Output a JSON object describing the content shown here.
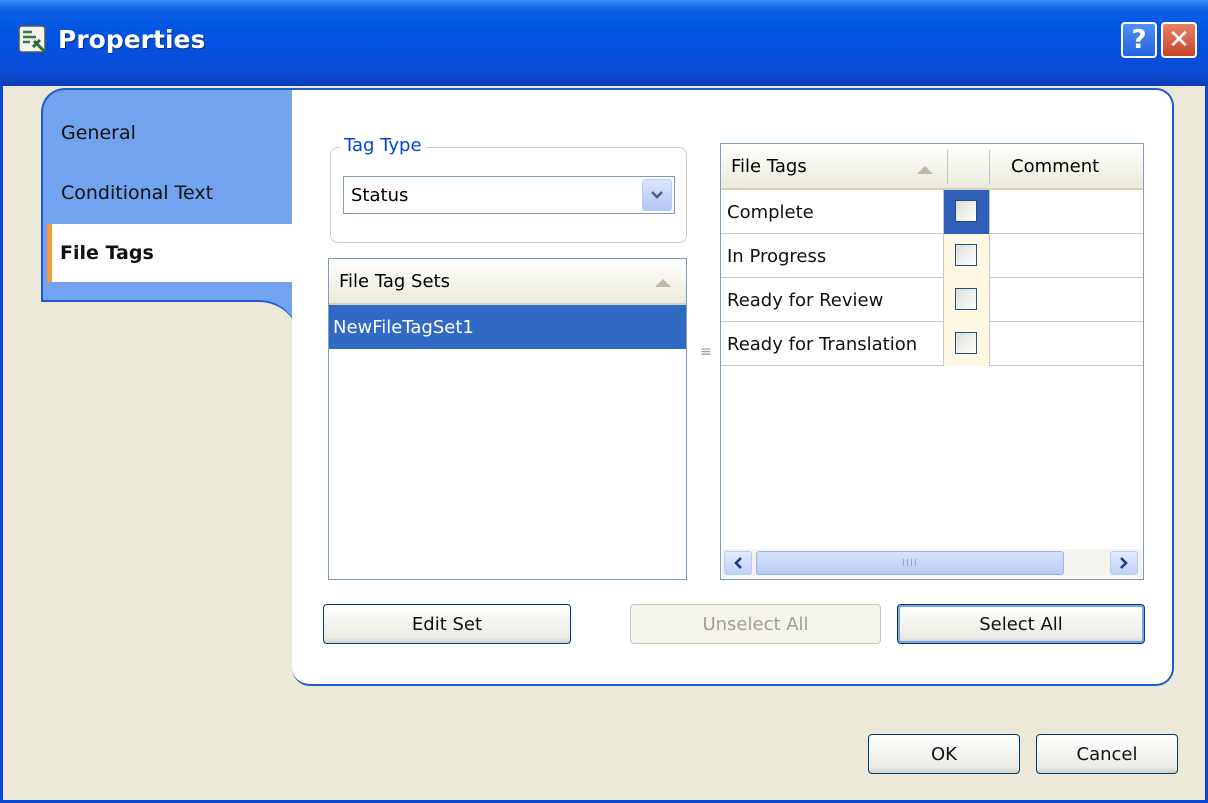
{
  "window": {
    "title": "Properties"
  },
  "titlebar": {
    "help_label": "?",
    "close_label": "✕"
  },
  "sidebar": {
    "tabs": [
      {
        "label": "General"
      },
      {
        "label": "Conditional Text"
      },
      {
        "label": "File Tags",
        "selected": true
      }
    ]
  },
  "tag_type": {
    "legend": "Tag Type",
    "selected_value": "Status"
  },
  "file_tag_sets": {
    "header": "File Tag Sets",
    "items": [
      "NewFileTagSet1"
    ],
    "selected_index": 0
  },
  "file_tags": {
    "columns": [
      "File Tags",
      "",
      "Comment"
    ],
    "rows": [
      {
        "name": "Complete",
        "checked": false,
        "comment": ""
      },
      {
        "name": "In Progress",
        "checked": false,
        "comment": ""
      },
      {
        "name": "Ready for Review",
        "checked": false,
        "comment": ""
      },
      {
        "name": "Ready for Translation",
        "checked": false,
        "comment": ""
      }
    ],
    "scrollbar_grip": "IIII"
  },
  "buttons": {
    "edit_set": "Edit Set",
    "unselect_all": "Unselect All",
    "select_all": "Select All",
    "ok": "OK",
    "cancel": "Cancel"
  },
  "colors": {
    "titlebar": "#0054e3",
    "tab_strip": "#71a3ee",
    "selection": "#316ac5",
    "tab_accent": "#f59a3a",
    "legend_text": "#0046d5"
  },
  "icons": {
    "app": "properties-app-icon",
    "combo_arrow": "chevron-down-icon",
    "scroll_left": "chevron-left-icon",
    "scroll_right": "chevron-right-icon"
  }
}
